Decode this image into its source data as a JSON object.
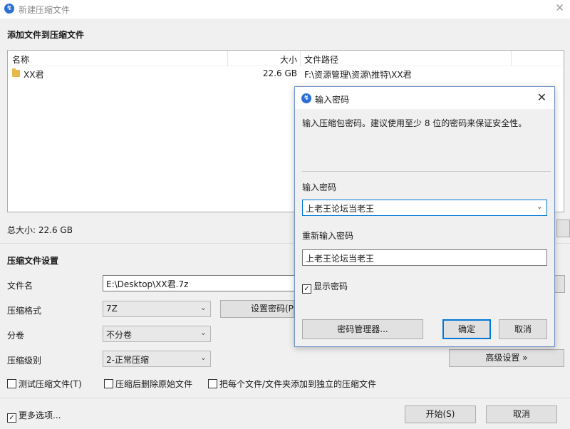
{
  "main": {
    "title": "新建压缩文件",
    "close_glyph": "✕",
    "add_section": "添加文件到压缩文件",
    "table": {
      "columns": [
        "名称",
        "大小",
        "文件路径"
      ],
      "rows": [
        {
          "name": "XX君",
          "size": "22.6 GB",
          "path": "F:\\资源管理\\资源\\推特\\XX君"
        }
      ]
    },
    "total_size": "总大小: 22.6 GB",
    "settings_section": "压缩文件设置",
    "filename_label": "文件名",
    "filename_value": "E:\\Desktop\\XX君.7z",
    "format_label": "压缩格式",
    "format_value": "7Z",
    "set_password_button": "设置密码(P)...",
    "volume_label": "分卷",
    "volume_value": "不分卷",
    "level_label": "压缩级别",
    "level_value": "2-正常压缩",
    "advanced_button": "高级设置 »",
    "test_checkbox": "测试压缩文件(T)",
    "delete_checkbox": "压缩后删除原始文件",
    "separate_checkbox": "把每个文件/文件夹添加到独立的压缩文件",
    "more_options_checkbox": "更多选项...",
    "start_button": "开始(S)",
    "cancel_button": "取消"
  },
  "dialog": {
    "title": "输入密码",
    "close_glyph": "✕",
    "hint": "输入压缩包密码。建议使用至少 8 位的密码来保证安全性。",
    "password_label": "输入密码",
    "password_value": "上老王论坛当老王",
    "reenter_label": "重新输入密码",
    "reenter_value": "上老王论坛当老王",
    "show_password": "显示密码",
    "manager_button": "密码管理器...",
    "ok_button": "确定",
    "cancel_button": "取消"
  },
  "icons": {
    "logo": "app-logo-icon",
    "folder": "folder-icon",
    "chevron": "chevron-down-icon",
    "check": "checkmark-icon"
  },
  "colors": {
    "accent": "#0078d7",
    "logo": "#2b6fd6",
    "folder": "#e8b84a"
  }
}
